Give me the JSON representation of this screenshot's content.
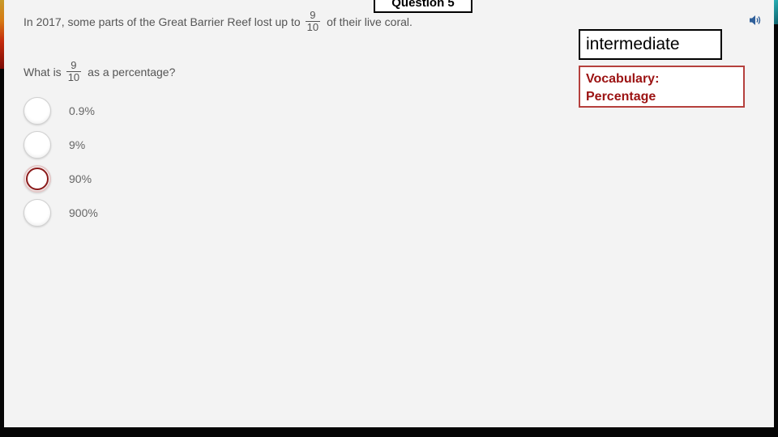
{
  "slide": {
    "question_tag": "Question 5",
    "level": "intermediate",
    "vocab_line1": "Vocabulary:",
    "vocab_line2": "Percentage"
  },
  "prompt": {
    "before": "In 2017, some parts of the Great Barrier Reef lost up to",
    "fraction_num": "9",
    "fraction_den": "10",
    "after": "of their live coral."
  },
  "question": {
    "before": "What is",
    "fraction_num": "9",
    "fraction_den": "10",
    "after": "as a percentage?"
  },
  "options": [
    {
      "label": "0.9%",
      "selected": false
    },
    {
      "label": "9%",
      "selected": false
    },
    {
      "label": "90%",
      "selected": true
    },
    {
      "label": "900%",
      "selected": false
    }
  ],
  "icons": {
    "audio": "speaker-icon"
  },
  "colors": {
    "selected_ring": "#8b1a1a",
    "vocab_text": "#9b1212",
    "vocab_border": "#b5403d",
    "speaker": "#2f5f9a"
  }
}
